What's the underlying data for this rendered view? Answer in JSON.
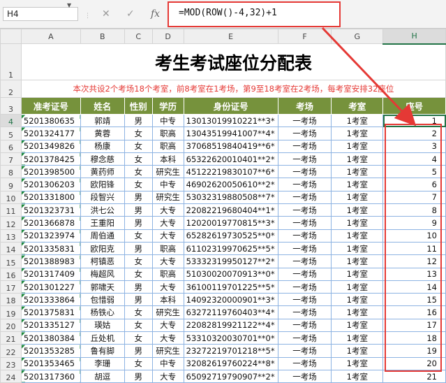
{
  "formula_bar": {
    "name_box": "H4",
    "cancel_icon": "✕",
    "enter_icon": "✓",
    "fx_label": "fx",
    "formula": "=MOD(ROW()-4,32)+1"
  },
  "columns": [
    "A",
    "B",
    "C",
    "D",
    "E",
    "F",
    "G",
    "H"
  ],
  "selected_column": "H",
  "sheet": {
    "title": "考生考试座位分配表",
    "note": "本次共设2个考场18个考室，前8考室在1考场，第9至18考室在2考场，每考室安排32座位",
    "headers": [
      "准考证号",
      "姓名",
      "性别",
      "学历",
      "身份证号",
      "考场",
      "考室",
      "座号"
    ],
    "rows": [
      {
        "row": "4",
        "id": "5201380635",
        "name": "郭靖",
        "gender": "男",
        "edu": "中专",
        "idcard": "13013019910221**3*",
        "site": "一考场",
        "room": "1考室",
        "seat": "1"
      },
      {
        "row": "5",
        "id": "5201324177",
        "name": "黄蓉",
        "gender": "女",
        "edu": "职高",
        "idcard": "13043519941007**4*",
        "site": "一考场",
        "room": "1考室",
        "seat": "2"
      },
      {
        "row": "6",
        "id": "5201349826",
        "name": "杨康",
        "gender": "女",
        "edu": "职高",
        "idcard": "37068519840419**6*",
        "site": "一考场",
        "room": "1考室",
        "seat": "3"
      },
      {
        "row": "7",
        "id": "5201378425",
        "name": "穆念慈",
        "gender": "女",
        "edu": "本科",
        "idcard": "65322620010401**2*",
        "site": "一考场",
        "room": "1考室",
        "seat": "4"
      },
      {
        "row": "8",
        "id": "5201398500",
        "name": "黄药师",
        "gender": "女",
        "edu": "研究生",
        "idcard": "45122219830107**6*",
        "site": "一考场",
        "room": "1考室",
        "seat": "5"
      },
      {
        "row": "9",
        "id": "5201306203",
        "name": "欧阳锋",
        "gender": "女",
        "edu": "中专",
        "idcard": "46902620050610**2*",
        "site": "一考场",
        "room": "1考室",
        "seat": "6"
      },
      {
        "row": "10",
        "id": "5201331800",
        "name": "段智兴",
        "gender": "男",
        "edu": "研究生",
        "idcard": "53032319880508**7*",
        "site": "一考场",
        "room": "1考室",
        "seat": "7"
      },
      {
        "row": "11",
        "id": "5201323731",
        "name": "洪七公",
        "gender": "男",
        "edu": "大专",
        "idcard": "22082219680404**1*",
        "site": "一考场",
        "room": "1考室",
        "seat": "8"
      },
      {
        "row": "12",
        "id": "5201366878",
        "name": "王重阳",
        "gender": "男",
        "edu": "大专",
        "idcard": "12020019770815**3*",
        "site": "一考场",
        "room": "1考室",
        "seat": "9"
      },
      {
        "row": "13",
        "id": "5201323974",
        "name": "周伯通",
        "gender": "女",
        "edu": "大专",
        "idcard": "65282619730525**0*",
        "site": "一考场",
        "room": "1考室",
        "seat": "10"
      },
      {
        "row": "14",
        "id": "5201335831",
        "name": "欧阳克",
        "gender": "男",
        "edu": "职高",
        "idcard": "61102319970625**5*",
        "site": "一考场",
        "room": "1考室",
        "seat": "11"
      },
      {
        "row": "15",
        "id": "5201388983",
        "name": "柯镇恶",
        "gender": "女",
        "edu": "大专",
        "idcard": "53332319950127**2*",
        "site": "一考场",
        "room": "1考室",
        "seat": "12"
      },
      {
        "row": "16",
        "id": "5201317409",
        "name": "梅超风",
        "gender": "女",
        "edu": "职高",
        "idcard": "51030020070913**0*",
        "site": "一考场",
        "room": "1考室",
        "seat": "13"
      },
      {
        "row": "17",
        "id": "5201301227",
        "name": "郭啸天",
        "gender": "男",
        "edu": "大专",
        "idcard": "36100119701225**5*",
        "site": "一考场",
        "room": "1考室",
        "seat": "14"
      },
      {
        "row": "18",
        "id": "5201333864",
        "name": "包惜弱",
        "gender": "男",
        "edu": "本科",
        "idcard": "14092320000901**3*",
        "site": "一考场",
        "room": "1考室",
        "seat": "15"
      },
      {
        "row": "19",
        "id": "5201375831",
        "name": "杨铁心",
        "gender": "女",
        "edu": "研究生",
        "idcard": "63272119760403**4*",
        "site": "一考场",
        "room": "1考室",
        "seat": "16"
      },
      {
        "row": "20",
        "id": "5201335127",
        "name": "瑛姑",
        "gender": "女",
        "edu": "大专",
        "idcard": "22082819921122**4*",
        "site": "一考场",
        "room": "1考室",
        "seat": "17"
      },
      {
        "row": "21",
        "id": "5201380384",
        "name": "丘处机",
        "gender": "女",
        "edu": "大专",
        "idcard": "53310320030701**0*",
        "site": "一考场",
        "room": "1考室",
        "seat": "18"
      },
      {
        "row": "22",
        "id": "5201353285",
        "name": "鲁有脚",
        "gender": "男",
        "edu": "研究生",
        "idcard": "23272219701218**5*",
        "site": "一考场",
        "room": "1考室",
        "seat": "19"
      },
      {
        "row": "23",
        "id": "5201353465",
        "name": "李珊",
        "gender": "女",
        "edu": "中专",
        "idcard": "32082619760224**8*",
        "site": "一考场",
        "room": "1考室",
        "seat": "20"
      },
      {
        "row": "24",
        "id": "5201317360",
        "name": "胡逗",
        "gender": "男",
        "edu": "大专",
        "idcard": "65092719790907**2*",
        "site": "一考场",
        "room": "1考室",
        "seat": "21"
      }
    ]
  },
  "colors": {
    "header_bg": "#76923c",
    "highlight": "#e53935",
    "grid_border": "#8db3e2"
  }
}
